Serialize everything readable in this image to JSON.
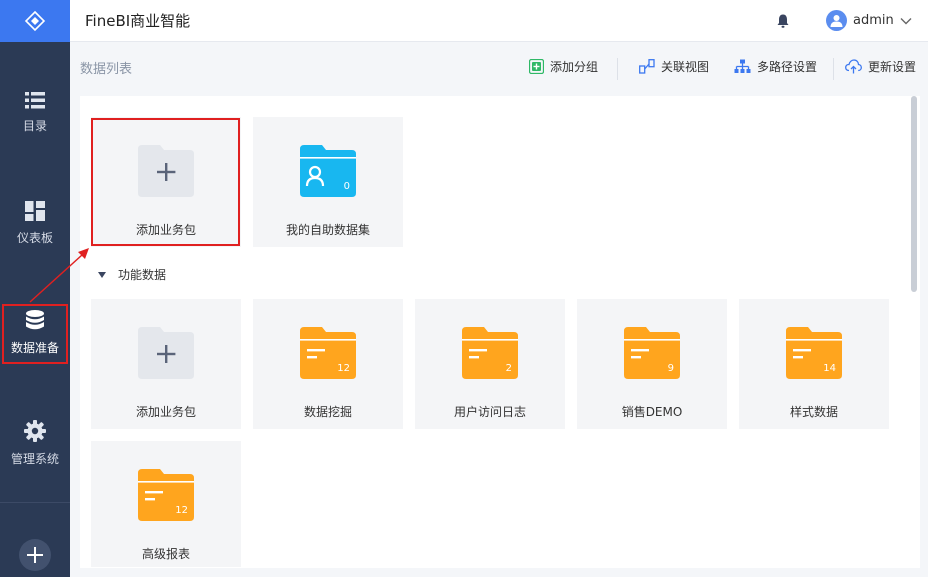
{
  "header": {
    "app_title": "FineBI商业智能",
    "user_name": "admin"
  },
  "sidebar": {
    "items": [
      {
        "label": "目录",
        "icon": "list-icon"
      },
      {
        "label": "仪表板",
        "icon": "dashboard-icon"
      },
      {
        "label": "数据准备",
        "icon": "database-icon"
      },
      {
        "label": "管理系统",
        "icon": "gear-icon"
      }
    ],
    "active_index": 2
  },
  "main": {
    "list_title": "数据列表",
    "toolbar": [
      {
        "label": "添加分组",
        "icon": "add-group-icon"
      },
      {
        "label": "关联视图",
        "icon": "relation-view-icon"
      },
      {
        "label": "多路径设置",
        "icon": "multipath-icon"
      },
      {
        "label": "更新设置",
        "icon": "cloud-update-icon"
      }
    ],
    "top_cards": [
      {
        "name": "添加业务包",
        "type": "add"
      },
      {
        "name": "我的自助数据集",
        "type": "self-service",
        "count": "0"
      }
    ],
    "section_title": "功能数据",
    "section_cards": [
      {
        "name": "添加业务包",
        "type": "add"
      },
      {
        "name": "数据挖掘",
        "type": "folder",
        "count": "12"
      },
      {
        "name": "用户访问日志",
        "type": "folder",
        "count": "2"
      },
      {
        "name": "销售DEMO",
        "type": "folder",
        "count": "9"
      },
      {
        "name": "样式数据",
        "type": "folder",
        "count": "14"
      },
      {
        "name": "高级报表",
        "type": "folder",
        "count": "12"
      }
    ]
  },
  "colors": {
    "sidebar_bg": "#2b3a55",
    "brand_blue": "#3c78f0",
    "folder_orange": "#ffa51e",
    "folder_blue": "#18b7f0",
    "highlight_red": "#e02020"
  }
}
